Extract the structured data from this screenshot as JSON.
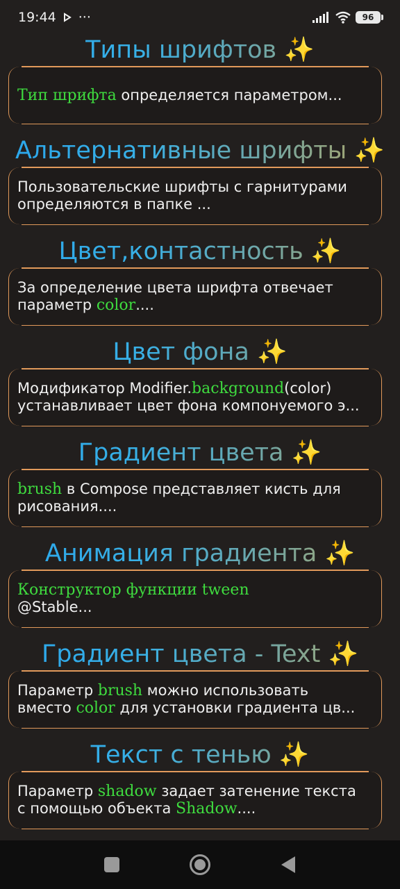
{
  "status_bar": {
    "time": "19:44",
    "extra": "···",
    "battery": "96",
    "icons": [
      "play-icon",
      "signal-icon",
      "wifi-icon",
      "battery-icon"
    ]
  },
  "sections": [
    {
      "title": "Типы шрифтов",
      "lines": [
        [
          {
            "t": "Тип шрифта",
            "hl": true
          },
          {
            "t": " определяется параметром..."
          }
        ]
      ]
    },
    {
      "title": "Альтернативные шрифты",
      "lines": [
        [
          {
            "t": "Пользовательские шрифты с гарнитурами"
          }
        ],
        [
          {
            "t": "определяются в папке ..."
          }
        ]
      ]
    },
    {
      "title": "Цвет,контастность",
      "lines": [
        [
          {
            "t": "За определение цвета шрифта отвечает"
          }
        ],
        [
          {
            "t": "параметр "
          },
          {
            "t": "color",
            "hl": true
          },
          {
            "t": "...."
          }
        ]
      ]
    },
    {
      "title": "Цвет фона ",
      "lines": [
        [
          {
            "t": "Модификатор Modifier."
          },
          {
            "t": "background",
            "hl": true
          },
          {
            "t": "(color)"
          }
        ],
        [
          {
            "t": "устанавливает цвет фона компонуемого э..."
          }
        ]
      ]
    },
    {
      "title": "Градиент цвета",
      "lines": [
        [
          {
            "t": "brush",
            "hl": true
          },
          {
            "t": " в Compose представляет кисть для"
          }
        ],
        [
          {
            "t": "рисования...."
          }
        ]
      ]
    },
    {
      "title": "Анимация градиента",
      "lines": [
        [
          {
            "t": "Конструктор функции tween",
            "hl": true
          }
        ],
        [
          {
            "t": "@Stable..."
          }
        ]
      ]
    },
    {
      "title": "Градиент цвета - Text",
      "lines": [
        [
          {
            "t": "Параметр "
          },
          {
            "t": "brush",
            "hl": true
          },
          {
            "t": " можно использовать"
          }
        ],
        [
          {
            "t": "вместо "
          },
          {
            "t": "color",
            "hl": true
          },
          {
            "t": " для установки градиента цв..."
          }
        ]
      ]
    },
    {
      "title": "Текст с тенью",
      "lines": [
        [
          {
            "t": "Параметр "
          },
          {
            "t": "shadow",
            "hl": true
          },
          {
            "t": " задает затенение текста"
          }
        ],
        [
          {
            "t": "с помощью объекта "
          },
          {
            "t": "Shadow",
            "hl": true
          },
          {
            "t": "...."
          }
        ]
      ]
    }
  ],
  "sparkle": "✨",
  "colors": {
    "accent_border": "#e29a5b",
    "highlight": "#3fdc3f",
    "title_gradient_start": "#2aa6ec",
    "title_gradient_end": "#b6a35a"
  },
  "nav_bar": {
    "icons": [
      "recents-icon",
      "home-icon",
      "back-icon"
    ]
  }
}
